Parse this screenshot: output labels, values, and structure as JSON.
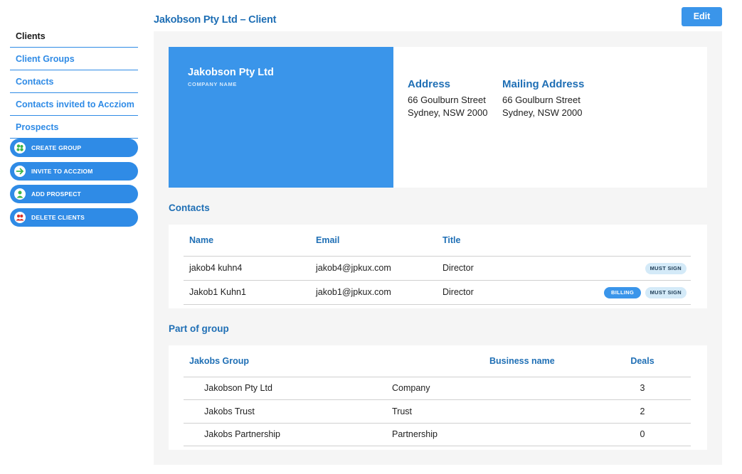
{
  "header": {
    "title": "Jakobson Pty Ltd – Client",
    "edit_label": "Edit"
  },
  "sidebar": {
    "nav": [
      {
        "label": "Clients",
        "active": true
      },
      {
        "label": "Client Groups"
      },
      {
        "label": "Contacts"
      },
      {
        "label": "Contacts invited to Accziom"
      },
      {
        "label": "Prospects"
      }
    ],
    "actions": [
      {
        "label": "CREATE GROUP",
        "icon": "group-icon",
        "icon_color": "#3bb54a"
      },
      {
        "label": "INVITE TO ACCZIOM",
        "icon": "arrow-right-icon",
        "icon_color": "#3bb54a"
      },
      {
        "label": "ADD PROSPECT",
        "icon": "person-icon",
        "icon_color": "#3bb54a"
      },
      {
        "label": "DELETE CLIENTS",
        "icon": "people-icon",
        "icon_color": "#d9342b"
      }
    ]
  },
  "company": {
    "name": "Jakobson Pty Ltd",
    "name_caption": "COMPANY NAME",
    "address": {
      "heading": "Address",
      "line1": "66 Goulburn Street",
      "line2": "Sydney, NSW 2000"
    },
    "mailing": {
      "heading": "Mailing Address",
      "line1": "66 Goulburn Street",
      "line2": "Sydney, NSW 2000"
    }
  },
  "contacts": {
    "title": "Contacts",
    "columns": [
      "Name",
      "Email",
      "Title"
    ],
    "rows": [
      {
        "name": "jakob4 kuhn4",
        "email": "jakob4@jpkux.com",
        "title": "Director",
        "badges": [
          "MUST SIGN"
        ]
      },
      {
        "name": "Jakob1 Kuhn1",
        "email": "jakob1@jpkux.com",
        "title": "Director",
        "badges": [
          "BILLING",
          "MUST SIGN"
        ]
      }
    ]
  },
  "group": {
    "title": "Part of group",
    "columns": [
      "Jakobs Group",
      "Business name",
      "Deals"
    ],
    "rows": [
      {
        "name": "Jakobson Pty Ltd",
        "type": "Company",
        "deals": "3"
      },
      {
        "name": "Jakobs Trust",
        "type": "Trust",
        "deals": "2"
      },
      {
        "name": "Jakobs Partnership",
        "type": "Partnership",
        "deals": "0"
      }
    ]
  },
  "colors": {
    "accent": "#3a95ea",
    "heading": "#1f6fb5",
    "panel_bg": "#f5f5f5"
  }
}
